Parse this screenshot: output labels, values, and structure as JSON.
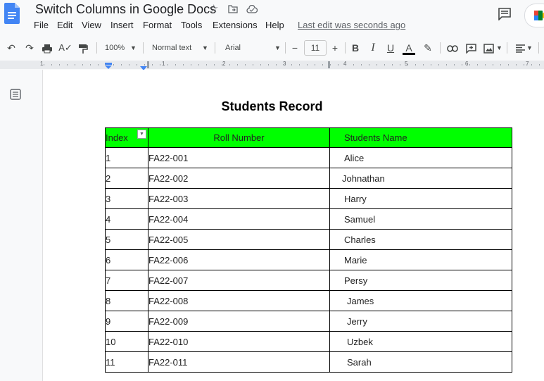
{
  "doc": {
    "title": "Switch Columns in Google Docs",
    "menu": [
      "File",
      "Edit",
      "View",
      "Insert",
      "Format",
      "Tools",
      "Extensions",
      "Help"
    ],
    "last_edit": "Last edit was seconds ago"
  },
  "toolbar": {
    "zoom": "100%",
    "style": "Normal text",
    "font": "Arial",
    "font_size": "11",
    "minus": "−",
    "plus": "+"
  },
  "ruler": [
    "1",
    "1",
    "2",
    "3",
    "4",
    "5",
    "6",
    "7"
  ],
  "content": {
    "heading": "Students Record",
    "headers": [
      "Index",
      "Roll Number",
      "Students Name"
    ],
    "rows": [
      [
        "1",
        "FA22-001",
        "Alice"
      ],
      [
        "2",
        "FA22-002",
        "Johnathan"
      ],
      [
        "3",
        "FA22-003",
        "Harry"
      ],
      [
        "4",
        "FA22-004",
        "Samuel"
      ],
      [
        "5",
        "FA22-005",
        "Charles"
      ],
      [
        "6",
        "FA22-006",
        "Marie"
      ],
      [
        "7",
        "FA22-007",
        "Persy"
      ],
      [
        "8",
        "FA22-008",
        "James"
      ],
      [
        "9",
        "FA22-009",
        "Jerry"
      ],
      [
        "10",
        "FA22-010",
        "Uzbek"
      ],
      [
        "11",
        "FA22-011",
        "Sarah"
      ]
    ],
    "header_color": "#00ff00"
  }
}
